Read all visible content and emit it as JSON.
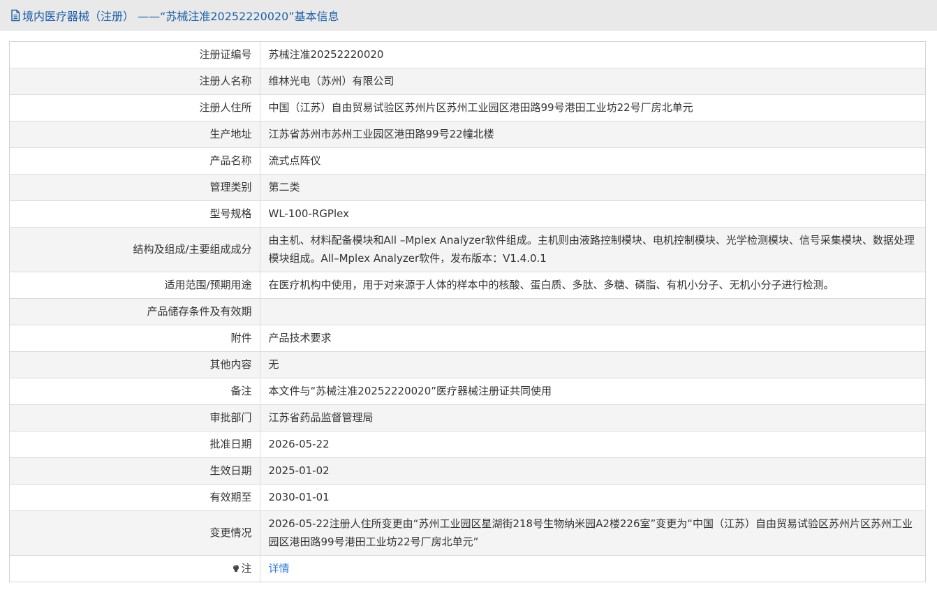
{
  "header": {
    "title": "境内医疗器械（注册） ——“苏械注准20252220020”基本信息",
    "icon": "document-icon"
  },
  "rows": [
    {
      "label": "注册证编号",
      "value": "苏械注准20252220020"
    },
    {
      "label": "注册人名称",
      "value": "维林光电（苏州）有限公司"
    },
    {
      "label": "注册人住所",
      "value": "中国（江苏）自由贸易试验区苏州片区苏州工业园区港田路99号港田工业坊22号厂房北单元"
    },
    {
      "label": "生产地址",
      "value": "江苏省苏州市苏州工业园区港田路99号22幢北楼"
    },
    {
      "label": "产品名称",
      "value": "流式点阵仪"
    },
    {
      "label": "管理类别",
      "value": "第二类"
    },
    {
      "label": "型号规格",
      "value": "WL-100-RGPlex"
    },
    {
      "label": "结构及组成/主要组成成分",
      "value": "由主机、材料配备模块和All –Mplex Analyzer软件组成。主机则由液路控制模块、电机控制模块、光学检测模块、信号采集模块、数据处理模块组成。All–Mplex Analyzer软件，发布版本：V1.4.0.1"
    },
    {
      "label": "适用范围/预期用途",
      "value": "在医疗机构中使用，用于对来源于人体的样本中的核酸、蛋白质、多肽、多糖、磷脂、有机小分子、无机小分子进行检测。"
    },
    {
      "label": "产品储存条件及有效期",
      "value": ""
    },
    {
      "label": "附件",
      "value": "产品技术要求"
    },
    {
      "label": "其他内容",
      "value": "无"
    },
    {
      "label": "备注",
      "value": "本文件与“苏械注准20252220020”医疗器械注册证共同使用"
    },
    {
      "label": "审批部门",
      "value": "江苏省药品监督管理局"
    },
    {
      "label": "批准日期",
      "value": "2026-05-22"
    },
    {
      "label": "生效日期",
      "value": "2025-01-02"
    },
    {
      "label": "有效期至",
      "value": "2030-01-01"
    },
    {
      "label": "变更情况",
      "value": "2026-05-22注册人住所变更由“苏州工业园区星湖街218号生物纳米园A2楼226室”变更为“中国（江苏）自由贸易试验区苏州片区苏州工业园区港田路99号港田工业坊22号厂房北单元”"
    }
  ],
  "note_row": {
    "label": "注",
    "icon": "lightbulb-icon",
    "link_text": "详情"
  },
  "colors": {
    "header_bg": "#e9e9e9",
    "header_text": "#1d5fa8",
    "link": "#2f7ad3",
    "row_alt": "#f4f4f4"
  }
}
